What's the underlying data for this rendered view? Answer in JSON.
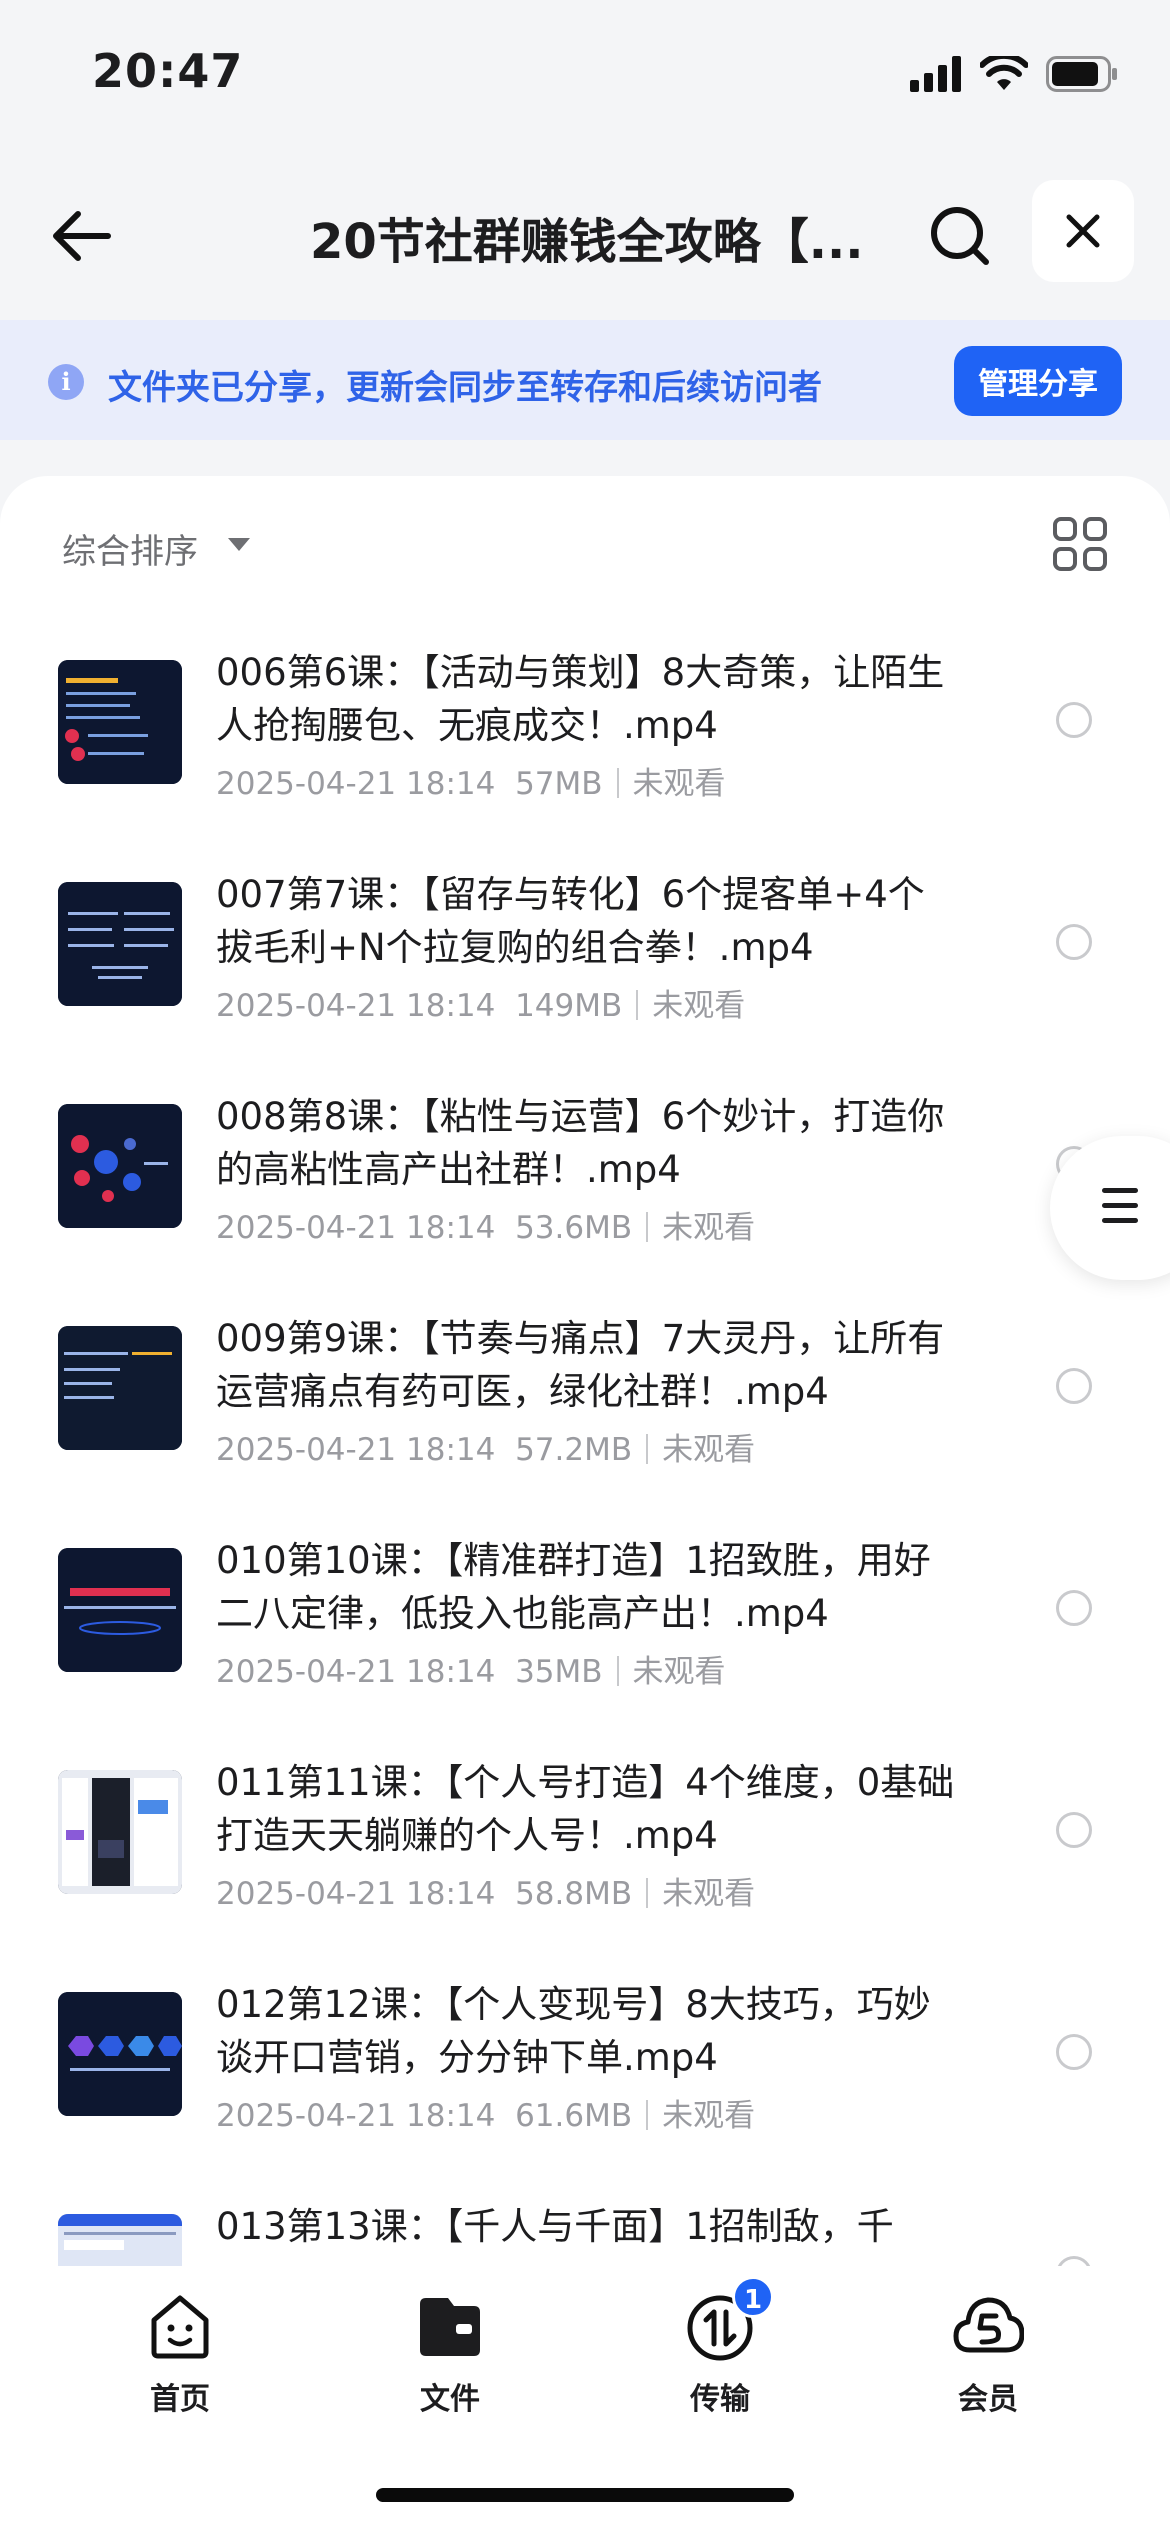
{
  "status": {
    "time": "20:47"
  },
  "nav": {
    "title": "20节社群赚钱全攻略【...",
    "icons": [
      "back-arrow-icon",
      "search-icon",
      "close-icon"
    ]
  },
  "banner": {
    "text": "文件夹已分享，更新会同步至转存和后续访问者",
    "button": "管理分享",
    "accent": "#1f63f5"
  },
  "sort": {
    "label": "综合排序"
  },
  "files": [
    {
      "title": "006第6课：【活动与策划】8大奇策，让陌生人抢掏腰包、无痕成交！.mp4",
      "date": "2025-04-21 18:14",
      "size": "57MB",
      "status": "未观看"
    },
    {
      "title": "007第7课：【留存与转化】6个提客单+4个拔毛利+N个拉复购的组合拳！.mp4",
      "date": "2025-04-21 18:14",
      "size": "149MB",
      "status": "未观看"
    },
    {
      "title": "008第8课：【粘性与运营】6个妙计，打造你的高粘性高产出社群！.mp4",
      "date": "2025-04-21 18:14",
      "size": "53.6MB",
      "status": "未观看"
    },
    {
      "title": "009第9课：【节奏与痛点】7大灵丹，让所有运营痛点有药可医，绿化社群！.mp4",
      "date": "2025-04-21 18:14",
      "size": "57.2MB",
      "status": "未观看"
    },
    {
      "title": "010第10课：【精准群打造】1招致胜，用好二八定律，低投入也能高产出！.mp4",
      "date": "2025-04-21 18:14",
      "size": "35MB",
      "status": "未观看"
    },
    {
      "title": "011第11课：【个人号打造】4个维度，0基础打造天天躺赚的个人号！.mp4",
      "date": "2025-04-21 18:14",
      "size": "58.8MB",
      "status": "未观看"
    },
    {
      "title": "012第12课：【个人变现号】8大技巧，巧妙谈开口营销，分分钟下单.mp4",
      "date": "2025-04-21 18:14",
      "size": "61.6MB",
      "status": "未观看"
    },
    {
      "title": "013第13课：【千人与千面】1招制敌，千",
      "date": "",
      "size": "",
      "status": ""
    }
  ],
  "tabs": [
    {
      "label": "首页",
      "icon": "smile-home-icon"
    },
    {
      "label": "文件",
      "icon": "folder-icon"
    },
    {
      "label": "传输",
      "icon": "transfer-icon",
      "badge": "1"
    },
    {
      "label": "会员",
      "icon": "cloud-vip-icon"
    }
  ]
}
